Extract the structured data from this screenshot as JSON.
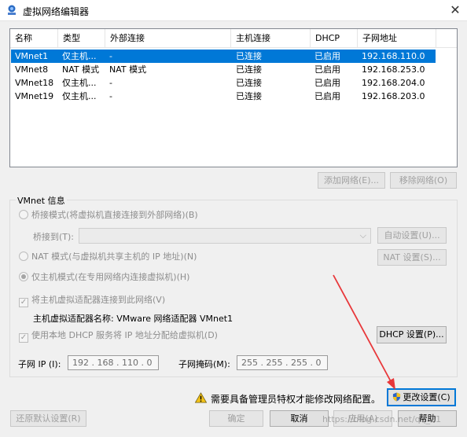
{
  "window": {
    "title": "虚拟网络编辑器",
    "close_glyph": "✕"
  },
  "list": {
    "columns": [
      "名称",
      "类型",
      "外部连接",
      "主机连接",
      "DHCP",
      "子网地址"
    ],
    "rows": [
      {
        "name": "VMnet1",
        "type": "仅主机...",
        "external": "-",
        "host": "已连接",
        "dhcp": "已启用",
        "subnet": "192.168.110.0",
        "selected": true
      },
      {
        "name": "VMnet8",
        "type": "NAT 模式",
        "external": "NAT 模式",
        "host": "已连接",
        "dhcp": "已启用",
        "subnet": "192.168.253.0"
      },
      {
        "name": "VMnet18",
        "type": "仅主机...",
        "external": "-",
        "host": "已连接",
        "dhcp": "已启用",
        "subnet": "192.168.204.0"
      },
      {
        "name": "VMnet19",
        "type": "仅主机...",
        "external": "-",
        "host": "已连接",
        "dhcp": "已启用",
        "subnet": "192.168.203.0"
      }
    ]
  },
  "list_buttons": {
    "add": "添加网络(E)...",
    "remove": "移除网络(O)"
  },
  "vmnet_info": {
    "title": "VMnet 信息",
    "bridge_radio": "桥接模式(将虚拟机直接连接到外部网络)(B)",
    "bridge_to_label": "桥接到(T):",
    "bridge_to_value": "",
    "auto_button": "自动设置(U)...",
    "nat_radio": "NAT 模式(与虚拟机共享主机的 IP 地址)(N)",
    "nat_button": "NAT 设置(S)...",
    "host_only_radio": "仅主机模式(在专用网络内连接虚拟机)(H)",
    "connect_adapter_check": "将主机虚拟适配器连接到此网络(V)",
    "adapter_name_label": "主机虚拟适配器名称: VMware 网络适配器 VMnet1",
    "dhcp_check": "使用本地 DHCP 服务将 IP 地址分配给虚拟机(D)",
    "dhcp_button": "DHCP 设置(P)...",
    "subnet_ip_label": "子网 IP (I):",
    "subnet_ip_value": "192 . 168 . 110 . 0",
    "subnet_mask_label": "子网掩码(M):",
    "subnet_mask_value": "255 . 255 . 255 . 0",
    "check_glyph": "✓"
  },
  "warning": {
    "text": "需要具备管理员特权才能修改网络配置。",
    "change_settings_button": "更改设置(C)"
  },
  "footer": {
    "restore_defaults": "还原默认设置(R)",
    "ok": "确定",
    "cancel": "取消",
    "apply": "应用(A)",
    "help": "帮助"
  },
  "watermark": "https://blog.csdn.net/qq_21",
  "colors": {
    "selection": "#0078d7",
    "arrow": "#e8373a",
    "window_bg": "#f0f0f0"
  },
  "icons": [
    "vmware-network-icon",
    "close-icon",
    "warning-icon",
    "uac-shield-icon",
    "dropdown-arrow-icon"
  ]
}
